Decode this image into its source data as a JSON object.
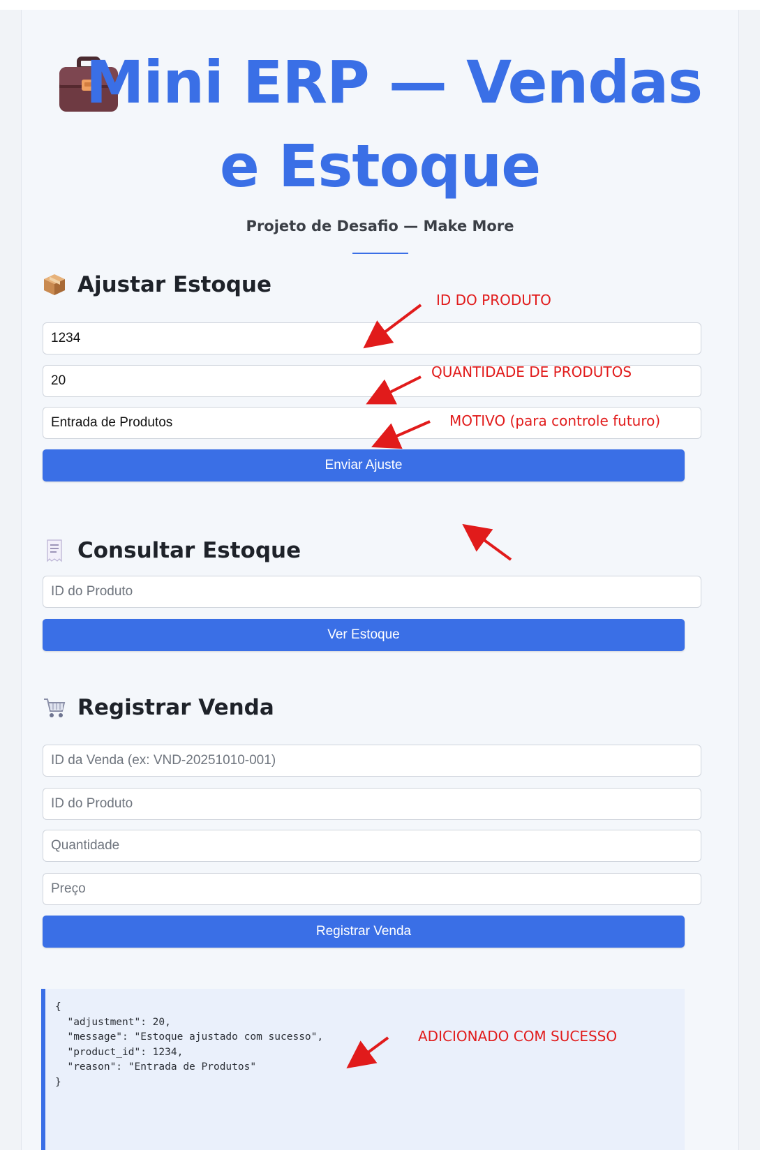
{
  "header": {
    "title_line1": "Mini ERP — Vendas",
    "title_line2": "e Estoque",
    "subtitle": "Projeto de Desafio — Make More"
  },
  "ajustar": {
    "title": "Ajustar Estoque",
    "icon": "package-icon",
    "product_id_value": "1234",
    "quantity_value": "20",
    "reason_value": "Entrada de Produtos",
    "submit_label": "Enviar Ajuste"
  },
  "consultar": {
    "title": "Consultar Estoque",
    "icon": "receipt-icon",
    "product_id_placeholder": "ID do Produto",
    "submit_label": "Ver Estoque"
  },
  "venda": {
    "title": "Registrar Venda",
    "icon": "shopping-cart-icon",
    "sale_id_placeholder": "ID da Venda (ex: VND-20251010-001)",
    "product_id_placeholder": "ID do Produto",
    "quantity_placeholder": "Quantidade",
    "price_placeholder": "Preço",
    "submit_label": "Registrar Venda"
  },
  "result": {
    "json_text": "{\n  \"adjustment\": 20,\n  \"message\": \"Estoque ajustado com sucesso\",\n  \"product_id\": 1234,\n  \"reason\": \"Entrada de Produtos\"\n}"
  },
  "annotations": {
    "product_id": "ID DO PRODUTO",
    "quantity": "QUANTIDADE DE PRODUTOS",
    "reason": "MOTIVO  (para controle futuro)",
    "success": "ADICIONADO COM SUCESSO"
  },
  "colors": {
    "accent": "#3a6fe6",
    "annotation": "#e11b1b",
    "background": "#f4f7fb"
  }
}
